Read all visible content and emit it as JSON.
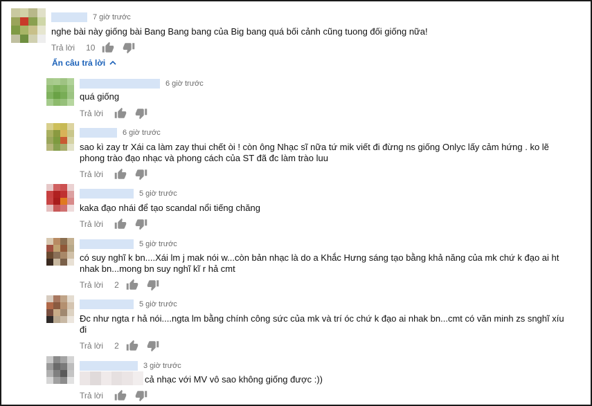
{
  "top_comment": {
    "time": "7 giờ trước",
    "text": "nghe bài này giống bài Bang Bang bang của Big bang quá bối cảnh cũng tuong đối giống nữa!",
    "reply_label": "Trả lời",
    "likes": "10"
  },
  "toggle_replies_label": "Ẩn câu trả lời",
  "replies": [
    {
      "time": "6 giờ trước",
      "lines": [
        "quá giống"
      ],
      "reply_label": "Trả lời",
      "likes": ""
    },
    {
      "time": "6 giờ trước",
      "lines": [
        "sao kì zay tr Xái ca làm zay thui chết òi ! còn ông Nhạc sĩ nữa tứ mik viết đi đừng ns giống Onlyc lấy cảm hứng . ko lẽ",
        "phong trào đạo nhạc và phong cách của ST đã đc làm trào luu"
      ],
      "reply_label": "Trả lời",
      "likes": ""
    },
    {
      "time": "5 giờ trước",
      "lines": [
        "kaka đạo nhái để tạo scandal nổi tiếng chăng"
      ],
      "reply_label": "Trả lời",
      "likes": ""
    },
    {
      "time": "5 giờ trước",
      "lines": [
        "có suy nghĩ k bn....Xái lm j mak nói w...còn bản nhạc là do a Khắc Hưng sáng tạo bằng khả năng của mk chứ k đạo ai ht",
        "nhak bn...mong bn suy nghĩ kĩ r hả cmt"
      ],
      "reply_label": "Trả lời",
      "likes": "2"
    },
    {
      "time": "5 giờ trước",
      "lines": [
        "Đc như ngta r hả nói....ngta lm bằng chính công sức của mk và trí óc chứ k đạo ai nhak bn...cmt có văn minh zs snghĩ xíu",
        "đi"
      ],
      "reply_label": "Trả lời",
      "likes": "2"
    },
    {
      "time": "3 giờ trước",
      "lines": [
        "cả nhạc với MV vô sao không giống được :))"
      ],
      "reply_label": "Trả lời",
      "likes": ""
    }
  ],
  "icons": [
    "thumb-up-icon",
    "thumb-down-icon",
    "chevron-up-icon"
  ],
  "colors": {
    "link": "#1c62b9",
    "meta": "#767676",
    "icon": "#909090"
  }
}
